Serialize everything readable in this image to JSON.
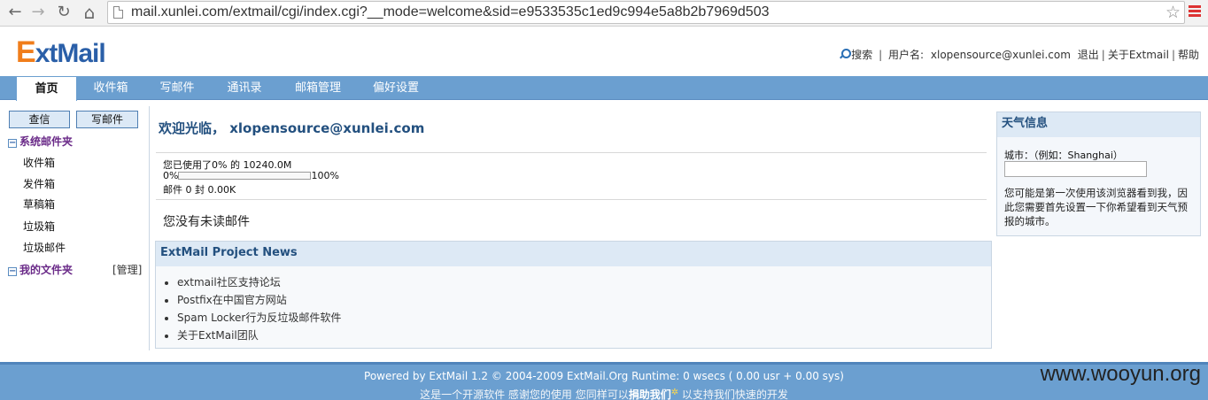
{
  "browser": {
    "url": "mail.xunlei.com/extmail/cgi/index.cgi?__mode=welcome&sid=e9533535c1ed9c994e5a8b2b7969d503",
    "back_glyph": "←",
    "forward_glyph": "→",
    "reload_glyph": "↻",
    "home_glyph": "⌂",
    "star_glyph": "☆"
  },
  "header": {
    "logo_e": "E",
    "logo_rest": "xtMail",
    "search": "搜索",
    "user_label": "用户名:",
    "user": "xlopensource@xunlei.com",
    "logout": "退出",
    "about": "关于Extmail",
    "help": "帮助",
    "sep": "|"
  },
  "nav": {
    "tabs": [
      "首页",
      "收件箱",
      "写邮件",
      "通讯录",
      "邮箱管理",
      "偏好设置"
    ]
  },
  "sidebar": {
    "check_mail": "查信",
    "compose": "写邮件",
    "system_folders": "系统邮件夹",
    "collapse_glyph": "−",
    "folders": [
      "收件箱",
      "发件箱",
      "草稿箱",
      "垃圾箱",
      "垃圾邮件"
    ],
    "my_folders": "我的文件夹",
    "manage": "[管理]"
  },
  "main": {
    "welcome": "欢迎光临， xlopensource@xunlei.com",
    "usage_line": "您已使用了0% 的 10240.0M",
    "quota_min": "0%",
    "quota_max": "100%",
    "quota_used_fraction": 0.0,
    "mail_count": "邮件 0 封 0.00K",
    "no_unread": "您没有未读邮件"
  },
  "news": {
    "title": "ExtMail Project News",
    "items": [
      "extmail社区支持论坛",
      "Postfix在中国官方网站",
      "Spam Locker行为反垃圾邮件软件",
      "关于ExtMail团队"
    ]
  },
  "weather": {
    "title": "天气信息",
    "city_label": "城市：（例如：Shanghai）",
    "city_value": "",
    "tip": "您可能是第一次使用该浏览器看到我，因此您需要首先设置一下你希望看到天气预报的城市。"
  },
  "footer": {
    "line1": "Powered by ExtMail 1.2 © 2004-2009 ExtMail.Org Runtime: 0 wsecs ( 0.00 usr + 0.00 sys)",
    "line2_pre": "这是一个开源软件 感谢您的使用 您同样可以",
    "donate": "捐助我们",
    "line2_post": " 以支持我们快速的开发"
  },
  "watermark": "www.wooyun.org",
  "colors": {
    "nav_bg": "#6b9fd0",
    "brand_blue": "#2a5fa8",
    "brand_orange": "#f07d1b",
    "folder_purple": "#6a2a88"
  }
}
